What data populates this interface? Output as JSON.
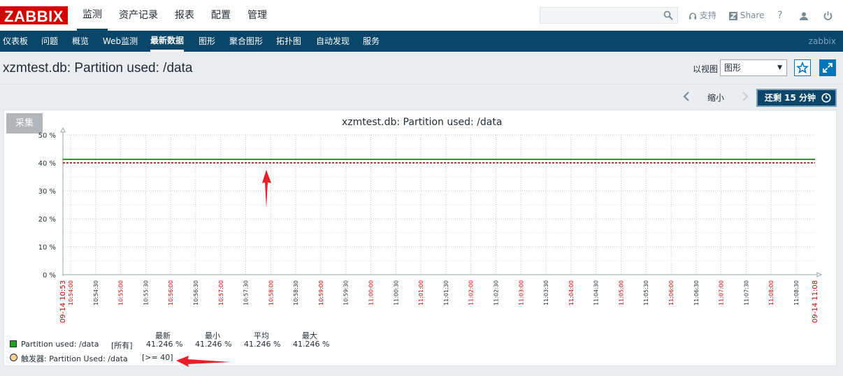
{
  "app": {
    "logo": "ZABBIX",
    "user": "zabbix"
  },
  "main_menu": [
    "监测",
    "资产记录",
    "报表",
    "配置",
    "管理"
  ],
  "header_tools": {
    "support": "支持",
    "share": "Share",
    "help": "?"
  },
  "sub_menu": [
    "仪表板",
    "问题",
    "概览",
    "Web监测",
    "最新数据",
    "图形",
    "聚合图形",
    "拓扑图",
    "自动发现",
    "服务"
  ],
  "page": {
    "title": "xzmtest.db: Partition used: /data",
    "view_label": "以视图",
    "view_value": "图形"
  },
  "timeline": {
    "zoom_out": "缩小",
    "time_button": "还剩 15 分钟"
  },
  "graph": {
    "collect_button": "采集"
  },
  "colors": {
    "series": "#1aa519",
    "trigger": "#8b0000",
    "header": "#0a466a",
    "accent": "#0275b8",
    "logo": "#d40000",
    "annotation": "#e8202a"
  },
  "chart_data": {
    "type": "line",
    "title": "xzmtest.db: Partition used: /data",
    "ylim": [
      0,
      50
    ],
    "y_ticks": [
      "50 %",
      "40 %",
      "30 %",
      "20 %",
      "10 %",
      "0 %"
    ],
    "x_ticks": [
      "09-14 10:53",
      "10:54:00",
      "10:54:30",
      "10:55:00",
      "10:55:30",
      "10:56:00",
      "10:56:30",
      "10:57:00",
      "10:57:30",
      "10:58:00",
      "10:58:30",
      "10:59:00",
      "10:59:30",
      "11:00:00",
      "11:00:30",
      "11:01:00",
      "11:01:30",
      "11:02:00",
      "11:02:30",
      "11:03:00",
      "11:03:30",
      "11:04:00",
      "11:04:30",
      "11:05:00",
      "11:05:30",
      "11:06:00",
      "11:06:30",
      "11:07:00",
      "11:07:30",
      "11:08:00",
      "11:08:30",
      "09-14 11:08"
    ],
    "series": [
      {
        "name": "Partition used: /data",
        "scope": "[所有]",
        "latest": "41.246 %",
        "min": "41.246 %",
        "avg": "41.246 %",
        "max": "41.246 %",
        "value": 41.246
      }
    ],
    "trigger": {
      "name": "触发器: Partition Used: /data",
      "condition": "[>= 40]",
      "value": 40
    },
    "legend_headers": [
      "最新",
      "最小",
      "平均",
      "最大"
    ],
    "grid": true
  }
}
